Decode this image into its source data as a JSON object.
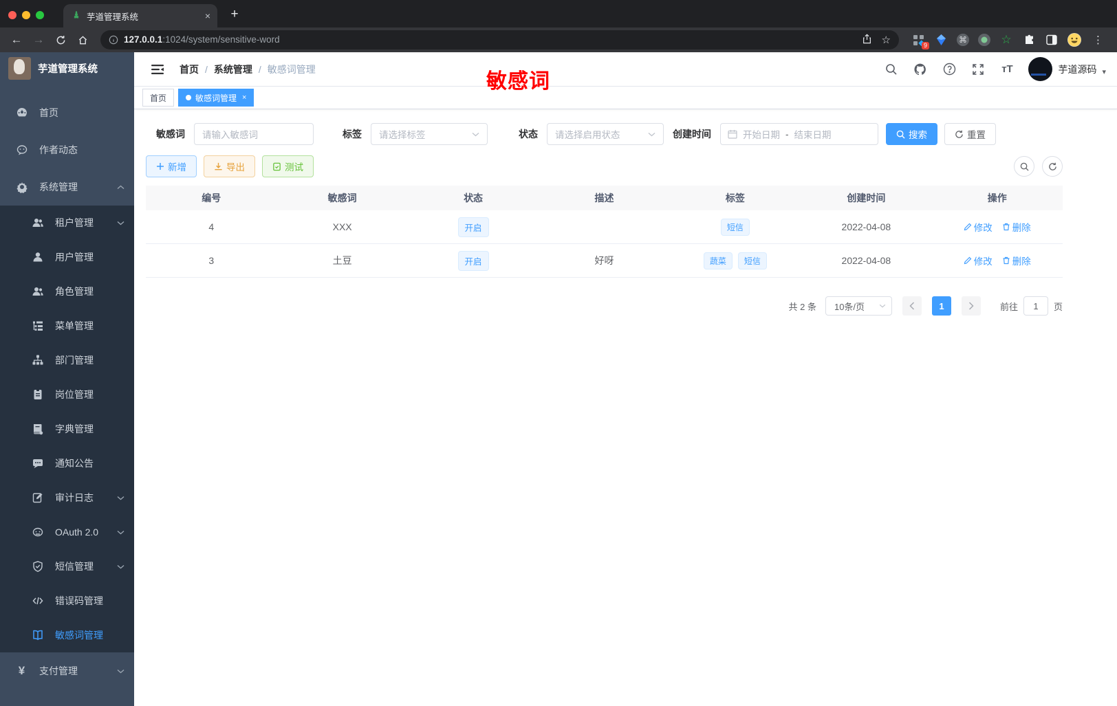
{
  "browser": {
    "tab_title": "芋道管理系统",
    "tab_close": "×",
    "new_tab": "+",
    "back": "←",
    "forward": "→",
    "url": {
      "host": "127.0.0.1",
      "rest": ":1024/system/sensitive-word"
    },
    "extension_badge": "9",
    "star": "☆",
    "command_glyph": "⌘",
    "menu_dots": "⋮"
  },
  "sidebar": {
    "logo_title": "芋道管理系统",
    "items": [
      {
        "label": "首页"
      },
      {
        "label": "作者动态"
      },
      {
        "label": "系统管理"
      },
      {
        "label": "租户管理"
      },
      {
        "label": "用户管理"
      },
      {
        "label": "角色管理"
      },
      {
        "label": "菜单管理"
      },
      {
        "label": "部门管理"
      },
      {
        "label": "岗位管理"
      },
      {
        "label": "字典管理"
      },
      {
        "label": "通知公告"
      },
      {
        "label": "审计日志"
      },
      {
        "label": "OAuth 2.0"
      },
      {
        "label": "短信管理"
      },
      {
        "label": "错误码管理"
      },
      {
        "label": "敏感词管理"
      },
      {
        "label": "支付管理"
      }
    ],
    "yen_glyph": "¥"
  },
  "header": {
    "breadcrumb": {
      "home": "首页",
      "section": "系统管理",
      "current": "敏感词管理",
      "separator": "/"
    },
    "watermark": "敏感词",
    "username": "芋道源码",
    "user_caret": "▾",
    "size_glyph": "тT"
  },
  "tagsbar": {
    "tabs": [
      {
        "label": "首页"
      },
      {
        "label": "敏感词管理",
        "close": "×"
      }
    ]
  },
  "filters": {
    "keyword_label": "敏感词",
    "keyword_placeholder": "请输入敏感词",
    "tag_label": "标签",
    "tag_placeholder": "请选择标签",
    "status_label": "状态",
    "status_placeholder": "请选择启用状态",
    "date_label": "创建时间",
    "date_start_placeholder": "开始日期",
    "date_separator": "-",
    "date_end_placeholder": "结束日期",
    "search_label": "搜索",
    "reset_label": "重置"
  },
  "toolbar": {
    "add_label": "新增",
    "export_label": "导出",
    "test_label": "测试"
  },
  "table": {
    "columns": {
      "id": "编号",
      "word": "敏感词",
      "status": "状态",
      "description": "描述",
      "tags": "标签",
      "created": "创建时间",
      "actions": "操作"
    },
    "rows": [
      {
        "id": "4",
        "word": "XXX",
        "status": "开启",
        "description": "",
        "tags": [
          "短信"
        ],
        "created": "2022-04-08",
        "edit": "修改",
        "delete": "删除"
      },
      {
        "id": "3",
        "word": "土豆",
        "status": "开启",
        "description": "好呀",
        "tags": [
          "蔬菜",
          "短信"
        ],
        "created": "2022-04-08",
        "edit": "修改",
        "delete": "删除"
      }
    ]
  },
  "pagination": {
    "total": "共 2 条",
    "page_size": "10条/页",
    "current_page": "1",
    "goto_label": "前往",
    "goto_value": "1",
    "page_unit": "页"
  },
  "colors": {
    "primary": "#409eff",
    "watermark_red": "#ff0000",
    "success": "#67c23a",
    "warning": "#e6a23c"
  }
}
